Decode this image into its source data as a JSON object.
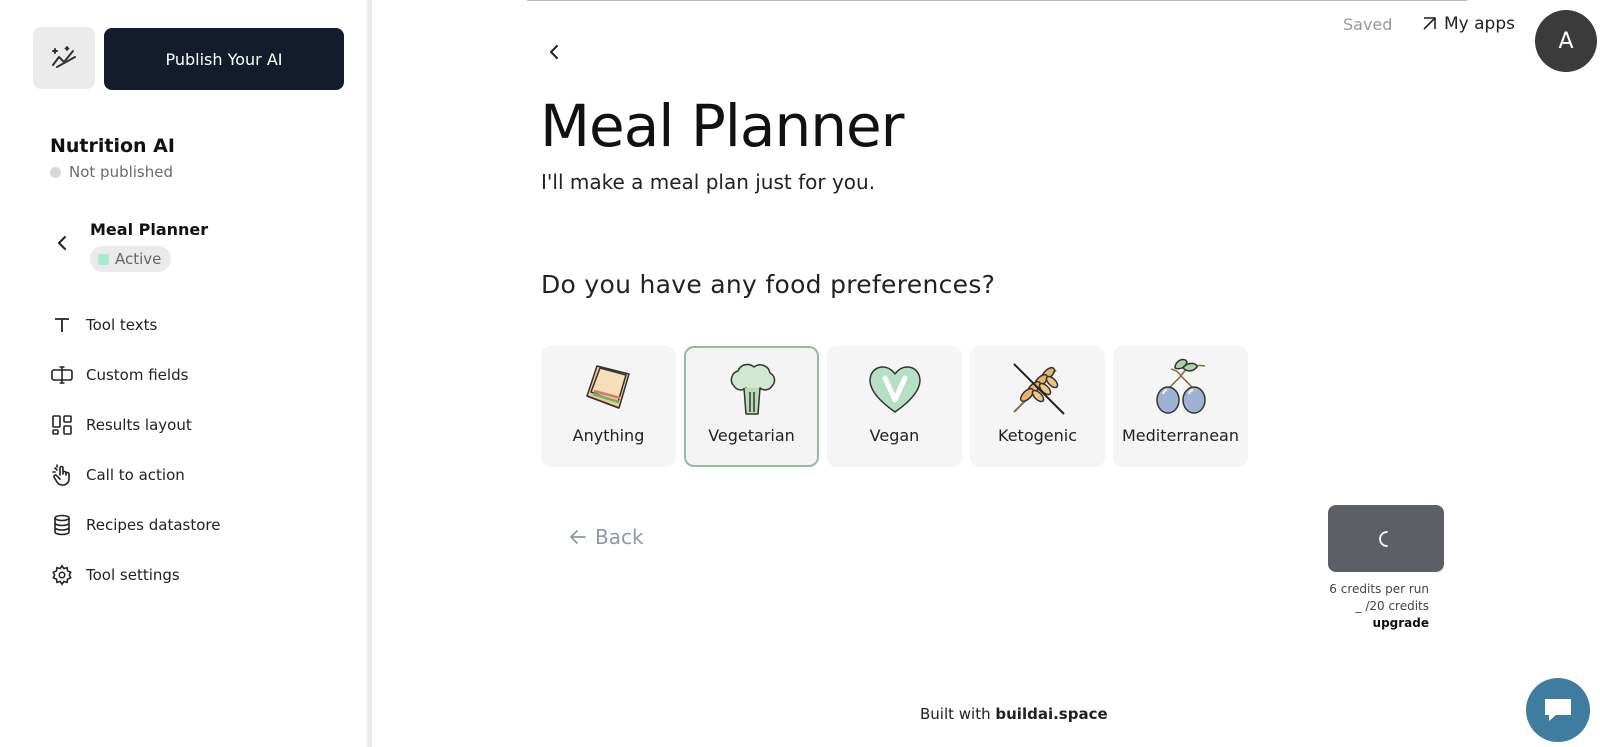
{
  "sidebar": {
    "publish_label": "Publish Your AI",
    "app_name": "Nutrition AI",
    "publish_status": "Not published",
    "tool_name": "Meal Planner",
    "tool_status": "Active",
    "menu": [
      {
        "label": "Tool texts",
        "icon": "text-icon"
      },
      {
        "label": "Custom fields",
        "icon": "text-cursor-input-icon"
      },
      {
        "label": "Results layout",
        "icon": "layout-icon"
      },
      {
        "label": "Call to action",
        "icon": "pointer-hand-icon"
      },
      {
        "label": "Recipes datastore",
        "icon": "database-icon"
      },
      {
        "label": "Tool settings",
        "icon": "gear-icon"
      }
    ]
  },
  "header": {
    "saved_label": "Saved",
    "my_apps_label": "My apps",
    "avatar_initial": "A"
  },
  "main": {
    "title": "Meal Planner",
    "subtitle": "I'll make a meal plan just for you.",
    "question": "Do you have any food preferences?",
    "options": [
      {
        "label": "Anything",
        "icon": "sandwich-icon",
        "selected": false
      },
      {
        "label": "Vegetarian",
        "icon": "broccoli-icon",
        "selected": true
      },
      {
        "label": "Vegan",
        "icon": "vegan-heart-icon",
        "selected": false
      },
      {
        "label": "Ketogenic",
        "icon": "no-wheat-icon",
        "selected": false
      },
      {
        "label": "Mediterranean",
        "icon": "olives-icon",
        "selected": false
      }
    ],
    "back_label": "Back",
    "credits_per_run": "6 credits per run",
    "credits_total": "_ /20 credits",
    "upgrade_label": "upgrade"
  },
  "footer": {
    "built_with": "Built with",
    "brand": "buildai.space"
  },
  "colors": {
    "publish_bg": "#141b2d",
    "selected_border": "#8fbf92",
    "run_button": "#5c5f66",
    "chat_button": "#3e7ca0",
    "active_dot": "#a7ecc8"
  }
}
